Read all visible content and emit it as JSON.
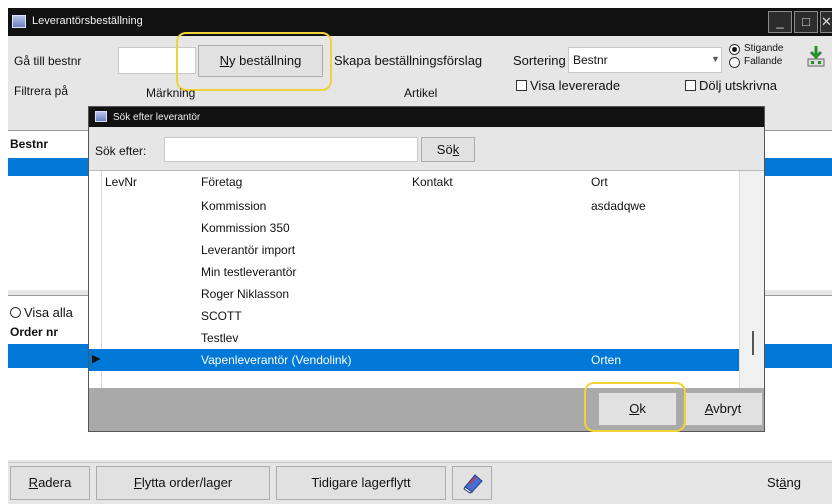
{
  "window": {
    "title": "Leverantörsbeställning",
    "min_label": "_",
    "max_label": "□",
    "close_label": "✕"
  },
  "toolbar": {
    "goto_label": "Gå till bestnr",
    "goto_value": "",
    "new_order_label": "Ny beställning",
    "new_order_accel": "N",
    "new_order_rest": "y beställning",
    "suggest_label": "Skapa beställningsförslag",
    "sort_label": "Sortering",
    "sort_value": "Bestnr",
    "asc_label": "Stigande",
    "desc_label": "Fallande",
    "show_delivered_label": "Visa levererade",
    "hide_printed_label": "Dölj utskrivna",
    "filter_label": "Filtrera på",
    "marking_label": "Märkning",
    "article_label": "Artikel"
  },
  "upper_grid": {
    "header": "Bestnr"
  },
  "lower": {
    "show_all_label": "Visa alla",
    "header": "Order nr"
  },
  "dialog": {
    "title": "Sök efter leverantör",
    "search_label": "Sök efter:",
    "search_value": "",
    "search_button": "Sök",
    "search_button_pre": "Sö",
    "search_button_accel": "k",
    "columns": [
      "LevNr",
      "Företag",
      "Kontakt",
      "Ort"
    ],
    "rows": [
      {
        "levnr": "",
        "foretag": "Kommission",
        "kontakt": "",
        "ort": "asdadqwe"
      },
      {
        "levnr": "",
        "foretag": "Kommission 350",
        "kontakt": "",
        "ort": ""
      },
      {
        "levnr": "",
        "foretag": "Leverantör import",
        "kontakt": "",
        "ort": ""
      },
      {
        "levnr": "",
        "foretag": "Min testleverantör",
        "kontakt": "",
        "ort": ""
      },
      {
        "levnr": "",
        "foretag": "Roger Niklasson",
        "kontakt": "",
        "ort": ""
      },
      {
        "levnr": "",
        "foretag": "SCOTT",
        "kontakt": "",
        "ort": ""
      },
      {
        "levnr": "",
        "foretag": "Testlev",
        "kontakt": "",
        "ort": ""
      },
      {
        "levnr": "",
        "foretag": "Vapenleverantör (Vendolink)",
        "kontakt": "",
        "ort": "Orten"
      }
    ],
    "selected_row": 7,
    "ok_label": "Ok",
    "ok_accel": "O",
    "ok_rest": "k",
    "cancel_label": "Avbryt",
    "cancel_accel": "A",
    "cancel_rest": "vbryt"
  },
  "bottom": {
    "delete_label": "Radera",
    "delete_accel": "R",
    "delete_rest": "adera",
    "move_label": "Flytta order/lager",
    "move_accel": "F",
    "move_rest": "lytta order/lager",
    "earlier_label": "Tidigare lagerflytt",
    "close_label": "Stäng",
    "close_pre": "St",
    "close_accel": "ä",
    "close_rest": "ng"
  },
  "colors": {
    "selection": "#0078d7",
    "highlight": "#f2d23a",
    "titlebar": "#111111"
  },
  "icons": [
    "app-icon",
    "download-icon",
    "eraser-icon",
    "row-pointer-icon",
    "dropdown-arrow-icon"
  ]
}
